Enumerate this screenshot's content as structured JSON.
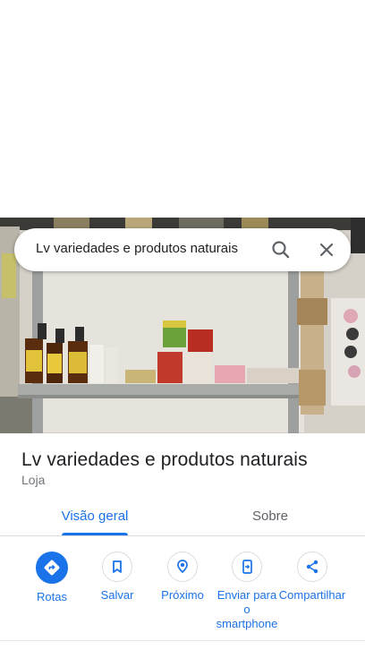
{
  "search": {
    "query": "Lv variedades e produtos naturais"
  },
  "place": {
    "name": "Lv variedades e produtos naturais",
    "category": "Loja"
  },
  "tabs": [
    {
      "label": "Visão geral",
      "active": true
    },
    {
      "label": "Sobre",
      "active": false
    }
  ],
  "actions": [
    {
      "label": "Rotas",
      "icon": "directions-icon"
    },
    {
      "label": "Salvar",
      "icon": "bookmark-icon"
    },
    {
      "label": "Próximo",
      "icon": "nearby-icon"
    },
    {
      "label": "Enviar para o smartphone",
      "icon": "send-to-phone-icon"
    },
    {
      "label": "Compartilhar",
      "icon": "share-icon"
    }
  ],
  "colors": {
    "accent": "#1a73e8",
    "text_primary": "#202124",
    "text_secondary": "#70757a"
  }
}
